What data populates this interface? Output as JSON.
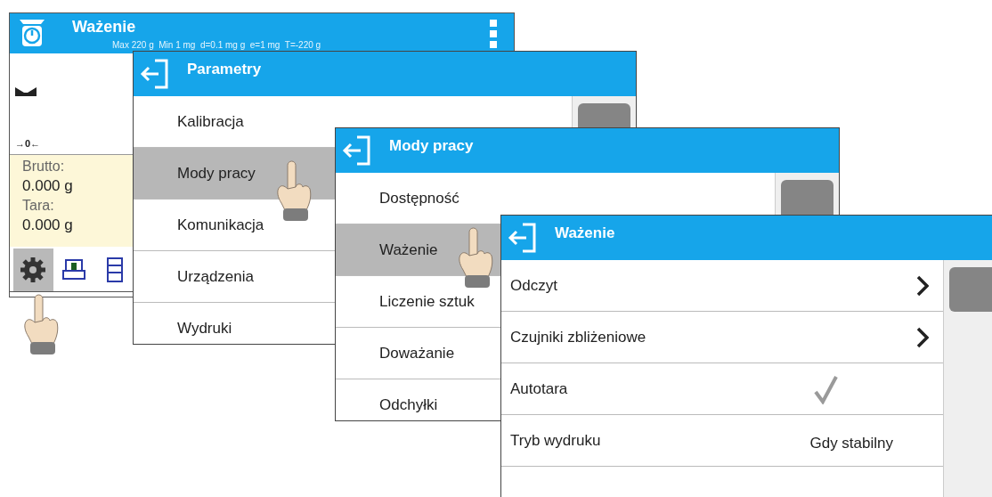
{
  "home": {
    "title": "Ważenie",
    "subtitle": "Max 220 g  Min 1 mg  d=0.1 mg g  e=1 mg  T=-220 g",
    "zero_indicator": "→0←",
    "readings": [
      {
        "label": "Brutto:",
        "value": "0.000 g"
      },
      {
        "label": "Tara:",
        "value": "0.000 g"
      }
    ],
    "toolbar": [
      {
        "kind": "settings",
        "selected": true
      },
      {
        "kind": "tare",
        "selected": false
      },
      {
        "kind": "print",
        "selected": false
      }
    ]
  },
  "menus": [
    {
      "title": "Parametry",
      "items": [
        {
          "label": "Kalibracja",
          "kind": "plain",
          "selected": false
        },
        {
          "label": "Mody pracy",
          "kind": "plain",
          "selected": true
        },
        {
          "label": "Komunikacja",
          "kind": "plain",
          "selected": false
        },
        {
          "label": "Urządzenia",
          "kind": "plain",
          "selected": false
        },
        {
          "label": "Wydruki",
          "kind": "plain",
          "selected": false
        }
      ]
    },
    {
      "title": "Mody pracy",
      "items": [
        {
          "label": "Dostępność",
          "kind": "plain",
          "selected": false
        },
        {
          "label": "Ważenie",
          "kind": "plain",
          "selected": true
        },
        {
          "label": "Liczenie sztuk",
          "kind": "plain",
          "selected": false
        },
        {
          "label": "Doważanie",
          "kind": "plain",
          "selected": false
        },
        {
          "label": "Odchyłki",
          "kind": "plain",
          "selected": false
        }
      ]
    },
    {
      "title": "Ważenie",
      "items": [
        {
          "label": "Odczyt",
          "kind": "submenu",
          "selected": false
        },
        {
          "label": "Czujniki zbliżeniowe",
          "kind": "submenu",
          "selected": false
        },
        {
          "label": "Autotara",
          "kind": "check",
          "checked": true,
          "selected": false
        },
        {
          "label": "Tryb wydruku",
          "kind": "value",
          "value": "Gdy stabilny",
          "selected": false
        }
      ]
    }
  ]
}
